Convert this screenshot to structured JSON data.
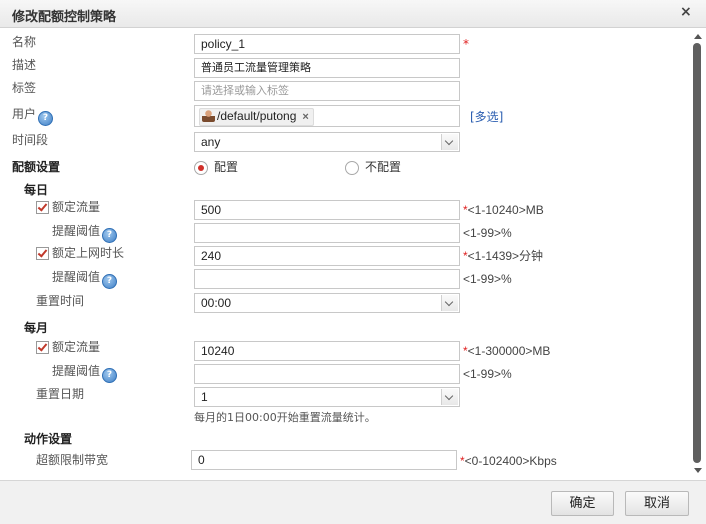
{
  "dialog": {
    "title": "修改配额控制策略",
    "close_glyph": "×"
  },
  "form": {
    "name_label": "名称",
    "name_value": "policy_1",
    "desc_label": "描述",
    "desc_value": "普通员工流量管理策略",
    "tag_label": "标签",
    "tag_placeholder": "请选择或输入标签",
    "user_label": "用户",
    "user_tag": "/default/putong",
    "user_tag_remove": "×",
    "multi_select": "[多选]",
    "time_label": "时间段",
    "time_value": "any",
    "quota_label": "配额设置",
    "quota_opt_on": "配置",
    "quota_opt_off": "不配置",
    "quota_selected": "配置",
    "required_mark": "*",
    "help_glyph": "?"
  },
  "daily": {
    "title": "每日",
    "traffic_label": "额定流量",
    "traffic_checked": true,
    "traffic_value": "500",
    "traffic_hint": "<1-10240>MB",
    "threshold_label": "提醒阈值",
    "threshold_value": "",
    "threshold_hint": "<1-99>%",
    "online_label": "额定上网时长",
    "online_checked": true,
    "online_value": "240",
    "online_hint": "<1-1439>分钟",
    "threshold2_label": "提醒阈值",
    "threshold2_value": "",
    "threshold2_hint": "<1-99>%",
    "reset_label": "重置时间",
    "reset_value": "00:00"
  },
  "monthly": {
    "title": "每月",
    "traffic_label": "额定流量",
    "traffic_checked": true,
    "traffic_value": "10240",
    "traffic_hint": "<1-300000>MB",
    "threshold_label": "提醒阈值",
    "threshold_value": "",
    "threshold_hint": "<1-99>%",
    "reset_label": "重置日期",
    "reset_value": "1",
    "reset_note": "每月的1日00:00开始重置流量统计。"
  },
  "action": {
    "title": "动作设置",
    "overlimit_label": "超额限制带宽",
    "overlimit_value": "0",
    "overlimit_hint": "<0-102400>Kbps"
  },
  "footer": {
    "ok_label": "确定",
    "cancel_label": "取消"
  },
  "colors": {
    "required": "#e02020",
    "link": "#2a5db0",
    "check": "#c0392b",
    "radio": "#d0302a"
  }
}
